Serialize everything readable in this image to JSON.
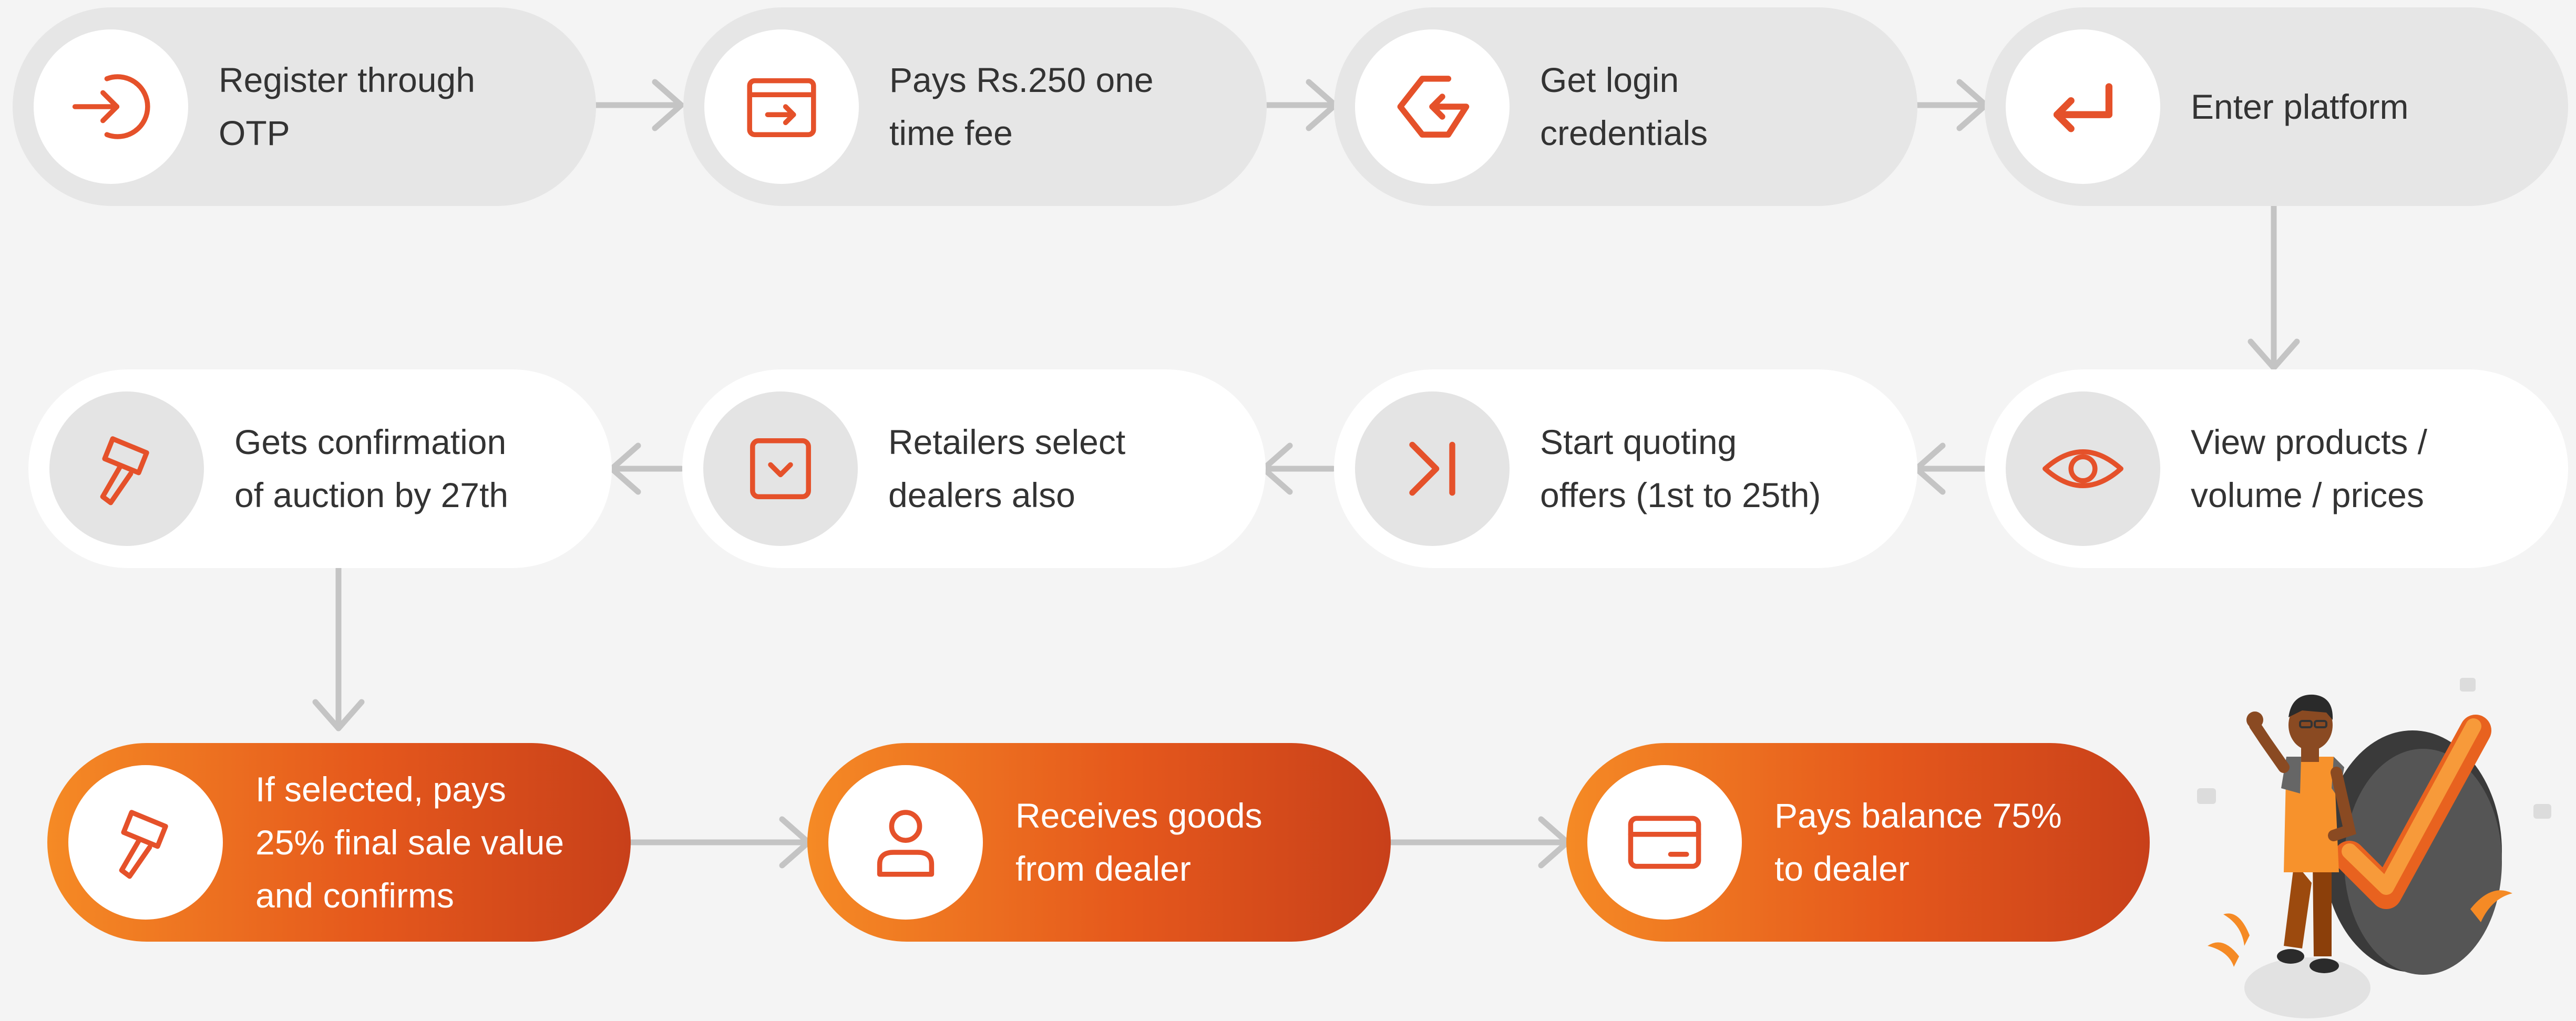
{
  "colors": {
    "accent": "#e5512a",
    "grey_pill": "#e6e6e6",
    "white_pill": "#ffffff",
    "orange_start": "#f58a25",
    "orange_end": "#c8401a",
    "arrow": "#c4c4c4"
  },
  "steps": [
    {
      "icon": "sign-in-icon",
      "lines": [
        "Register through",
        "OTP"
      ]
    },
    {
      "icon": "payment-icon",
      "lines": [
        "Pays Rs.250 one",
        "time fee"
      ]
    },
    {
      "icon": "login-g-icon",
      "lines": [
        "Get login",
        "credentials"
      ]
    },
    {
      "icon": "enter-return-icon",
      "lines": [
        "Enter platform"
      ]
    },
    {
      "icon": "eye-icon",
      "lines": [
        "View products /",
        "volume / prices"
      ]
    },
    {
      "icon": "skip-forward-icon",
      "lines": [
        "Start quoting",
        "offers (1st to 25th)"
      ]
    },
    {
      "icon": "dropdown-box-icon",
      "lines": [
        "Retailers select",
        "dealers also"
      ]
    },
    {
      "icon": "gavel-icon",
      "lines": [
        "Gets confirmation",
        "of auction by 27th"
      ]
    },
    {
      "icon": "gavel-icon",
      "lines": [
        "If selected, pays",
        "25% final sale value",
        "and confirms"
      ]
    },
    {
      "icon": "user-icon",
      "lines": [
        "Receives goods",
        "from dealer"
      ]
    },
    {
      "icon": "credit-card-icon",
      "lines": [
        "Pays balance 75%",
        "to dealer"
      ]
    }
  ],
  "illustration": {
    "icon": "person-with-checkmark-illustration"
  }
}
